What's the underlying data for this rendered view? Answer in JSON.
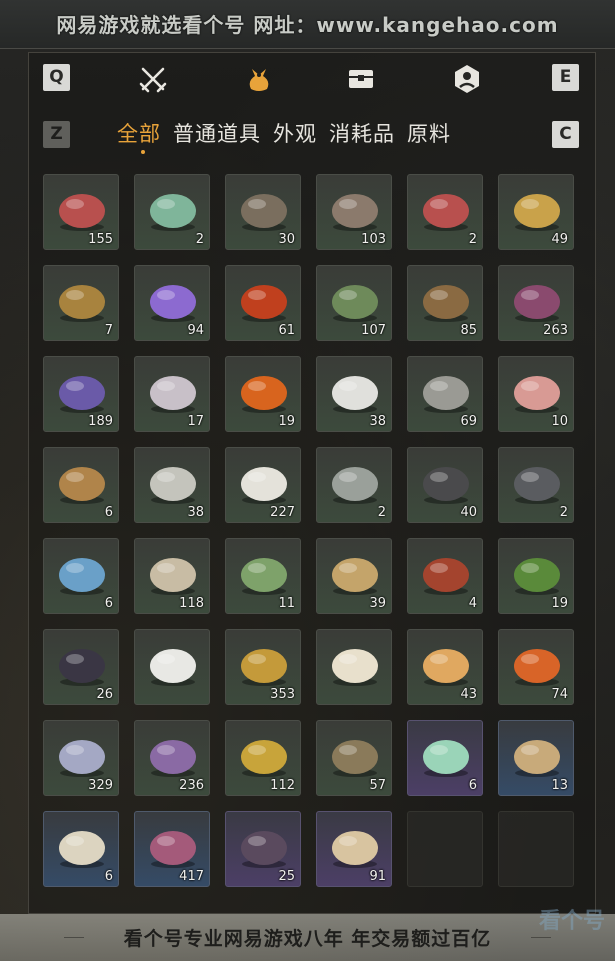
{
  "top_banner": "网易游戏就选看个号  网址：www.kangehao.com",
  "keys": {
    "q": "Q",
    "e": "E",
    "z": "Z",
    "c": "C"
  },
  "category_icons": [
    "swords-icon",
    "pouch-icon",
    "chest-icon",
    "badge-icon"
  ],
  "tabs": [
    {
      "label": "全部",
      "active": true
    },
    {
      "label": "普通道具",
      "active": false
    },
    {
      "label": "外观",
      "active": false
    },
    {
      "label": "消耗品",
      "active": false
    },
    {
      "label": "原料",
      "active": false
    }
  ],
  "items": [
    {
      "icon": "raw-meat-icon",
      "qty": "155",
      "color": "#b8504e"
    },
    {
      "icon": "jade-stone-icon",
      "qty": "2",
      "color": "#7fb59a"
    },
    {
      "icon": "feathers-icon",
      "qty": "30",
      "color": "#7a6e5e"
    },
    {
      "icon": "animal-pelt-icon",
      "qty": "103",
      "color": "#8b7a6c"
    },
    {
      "icon": "raw-meat-icon",
      "qty": "2",
      "color": "#b8504e"
    },
    {
      "icon": "carp-fish-icon",
      "qty": "49",
      "color": "#c9a24a"
    },
    {
      "icon": "gold-ore-icon",
      "qty": "7",
      "color": "#a8833e"
    },
    {
      "icon": "amethyst-icon",
      "qty": "94",
      "color": "#8c6ad0"
    },
    {
      "icon": "red-bean-icon",
      "qty": "61",
      "color": "#c0401e"
    },
    {
      "icon": "herb-sprig-icon",
      "qty": "107",
      "color": "#6e8a5a"
    },
    {
      "icon": "spice-bowl-icon",
      "qty": "85",
      "color": "#8a6a42"
    },
    {
      "icon": "purple-flower-icon",
      "qty": "263",
      "color": "#8a4a6e"
    },
    {
      "icon": "lavender-icon",
      "qty": "189",
      "color": "#6a5aa8"
    },
    {
      "icon": "white-blossom-icon",
      "qty": "17",
      "color": "#c8c0c8"
    },
    {
      "icon": "orange-flower-icon",
      "qty": "19",
      "color": "#d8641e"
    },
    {
      "icon": "white-feather-icon",
      "qty": "38",
      "color": "#e0e0dc"
    },
    {
      "icon": "grey-feather-icon",
      "qty": "69",
      "color": "#9a9a94"
    },
    {
      "icon": "sliced-meat-icon",
      "qty": "10",
      "color": "#d89a94"
    },
    {
      "icon": "fur-pelt-icon",
      "qty": "6",
      "color": "#b0844a"
    },
    {
      "icon": "quills-icon",
      "qty": "38",
      "color": "#c4c4bc"
    },
    {
      "icon": "white-fur-icon",
      "qty": "227",
      "color": "#e4e2da"
    },
    {
      "icon": "grey-fish-icon",
      "qty": "2",
      "color": "#9aa09a"
    },
    {
      "icon": "dark-ore-icon",
      "qty": "40",
      "color": "#4a4a4c"
    },
    {
      "icon": "dark-ore-icon",
      "qty": "2",
      "color": "#5a5c60"
    },
    {
      "icon": "blue-crystal-icon",
      "qty": "6",
      "color": "#6aa0c8"
    },
    {
      "icon": "bone-icon",
      "qty": "118",
      "color": "#c8bca4"
    },
    {
      "icon": "green-gourd-icon",
      "qty": "11",
      "color": "#7ea26a"
    },
    {
      "icon": "tied-bundle-icon",
      "qty": "39",
      "color": "#c4a46a"
    },
    {
      "icon": "berry-twig-icon",
      "qty": "4",
      "color": "#a4442e"
    },
    {
      "icon": "leafy-herb-icon",
      "qty": "19",
      "color": "#5a8a3a"
    },
    {
      "icon": "black-feather-icon",
      "qty": "26",
      "color": "#3a3644"
    },
    {
      "icon": "fluffy-tail-icon",
      "qty": "",
      "color": "#e8e8e4"
    },
    {
      "icon": "gold-ornament-icon",
      "qty": "353",
      "color": "#c49a3a"
    },
    {
      "icon": "milk-bowl-icon",
      "qty": "",
      "color": "#e8e0cc"
    },
    {
      "icon": "candy-pieces-icon",
      "qty": "43",
      "color": "#e0a860"
    },
    {
      "icon": "orange-stone-icon",
      "qty": "74",
      "color": "#d86428"
    },
    {
      "icon": "spiky-flower-icon",
      "qty": "329",
      "color": "#a4a8c4"
    },
    {
      "icon": "purple-spike-icon",
      "qty": "236",
      "color": "#8a6aa4"
    },
    {
      "icon": "yellow-flower-icon",
      "qty": "112",
      "color": "#c8a43a"
    },
    {
      "icon": "root-herb-icon",
      "qty": "57",
      "color": "#8a7a5a"
    },
    {
      "icon": "gift-box-icon",
      "qty": "6",
      "color": "#9ad4b8"
    },
    {
      "icon": "scroll-icon",
      "qty": "13",
      "color": "#c8aa7a"
    },
    {
      "icon": "ceramic-jar-icon",
      "qty": "6",
      "color": "#dcd4c0"
    },
    {
      "icon": "color-box-icon",
      "qty": "417",
      "color": "#a45a7a"
    },
    {
      "icon": "dark-horn-icon",
      "qty": "25",
      "color": "#5a4a5e"
    },
    {
      "icon": "horn-icon",
      "qty": "91",
      "color": "#d8c4a0"
    },
    {
      "icon": "",
      "qty": "",
      "color": ""
    },
    {
      "icon": "",
      "qty": "",
      "color": ""
    }
  ],
  "footer_text": "看个号专业网易游戏八年 年交易额过百亿",
  "watermark": "看个号"
}
